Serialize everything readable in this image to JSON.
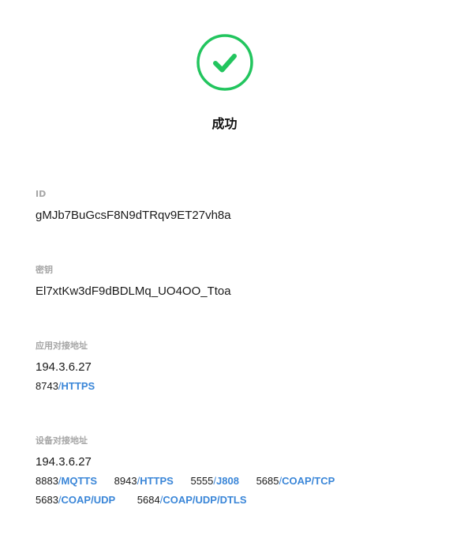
{
  "status": {
    "icon": "check-circle-icon",
    "color": "#22c55e",
    "title": "成功"
  },
  "fields": {
    "id": {
      "label": "ID",
      "value": "gMJb7BuGcsF8N9dTRqv9ET27vh8a"
    },
    "secret": {
      "label": "密钥",
      "value": "El7xtKw3dF9dBDLMq_UO4OO_Ttoa"
    },
    "app_address": {
      "label": "应用对接地址",
      "host": "194.3.6.27",
      "ports": [
        {
          "port": "8743",
          "protocol": "HTTPS"
        }
      ]
    },
    "device_address": {
      "label": "设备对接地址",
      "host": "194.3.6.27",
      "ports_line1": [
        {
          "port": "8883",
          "protocol": "MQTTS"
        },
        {
          "port": "8943",
          "protocol": "HTTPS"
        },
        {
          "port": "5555",
          "protocol": "J808"
        },
        {
          "port": "5685",
          "protocol": "COAP/TCP"
        }
      ],
      "ports_line2": [
        {
          "port": "5683",
          "protocol": "COAP/UDP"
        },
        {
          "port": "5684",
          "protocol": "COAP/UDP/DTLS"
        }
      ]
    }
  },
  "colors": {
    "accent": "#3a86d8",
    "label": "#a6a6a6"
  }
}
